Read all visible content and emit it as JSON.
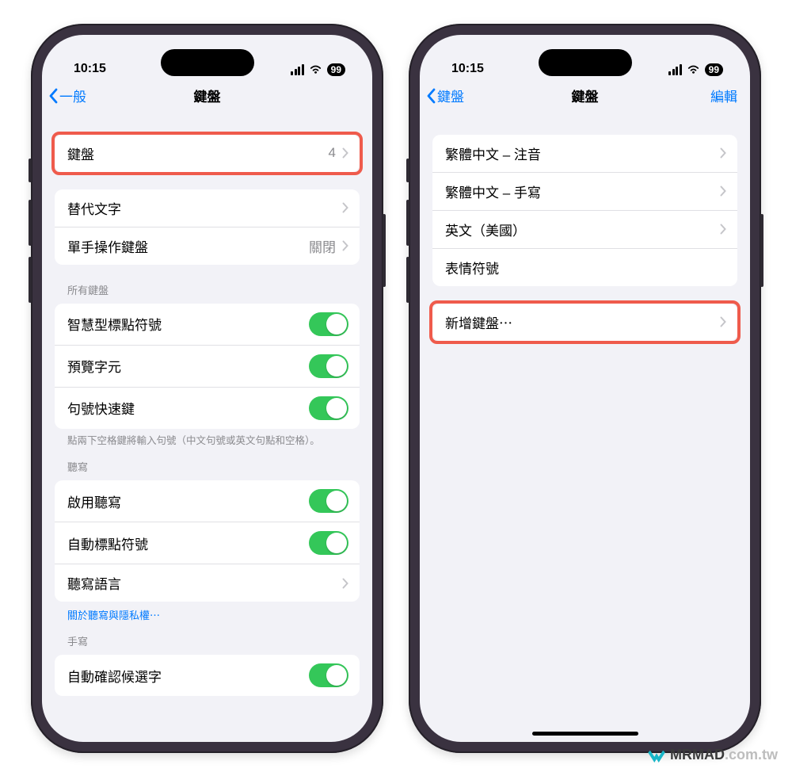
{
  "status": {
    "time": "10:15",
    "battery": "99"
  },
  "left": {
    "back": "一般",
    "title": "鍵盤",
    "row_keyboards": {
      "label": "鍵盤",
      "value": "4"
    },
    "row_text_replace": "替代文字",
    "row_one_hand": {
      "label": "單手操作鍵盤",
      "value": "關閉"
    },
    "header_all": "所有鍵盤",
    "row_smart_punct": "智慧型標點符號",
    "row_preview": "預覽字元",
    "row_period_shortcut": "句號快速鍵",
    "note_period": "點兩下空格鍵將輸入句號（中文句號或英文句點和空格）。",
    "header_dictation": "聽寫",
    "row_enable_dict": "啟用聽寫",
    "row_auto_punct": "自動標點符號",
    "row_dict_lang": "聽寫語言",
    "link_privacy": "關於聽寫與隱私權⋯",
    "header_handwrite": "手寫",
    "row_auto_confirm": "自動確認候選字"
  },
  "right": {
    "back": "鍵盤",
    "title": "鍵盤",
    "edit": "編輯",
    "kb1": "繁體中文 – 注音",
    "kb2": "繁體中文 – 手寫",
    "kb3": "英文（美國）",
    "kb4": "表情符號",
    "add": "新增鍵盤⋯"
  },
  "watermark": {
    "brand": "MRMAD",
    "domain": ".com.tw"
  }
}
